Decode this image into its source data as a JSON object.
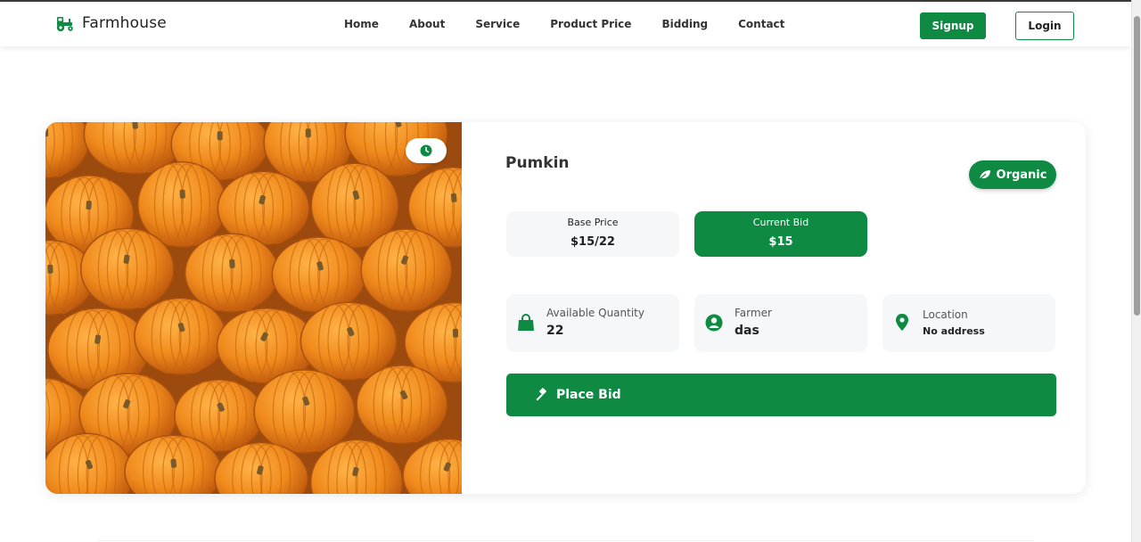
{
  "brand": {
    "name": "Farmhouse",
    "icon": "tractor-icon",
    "color": "#0e8a43"
  },
  "nav": {
    "links": [
      "Home",
      "About",
      "Service",
      "Product Price",
      "Bidding",
      "Contact"
    ],
    "signup_label": "Signup",
    "login_label": "Login"
  },
  "product": {
    "title": "Pumkin",
    "organic_label": "Organic",
    "base_price_label": "Base Price",
    "base_price_value": "$15/22",
    "current_bid_label": "Current Bid",
    "current_bid_value": "$15",
    "quantity_label": "Available Quantity",
    "quantity_value": "22",
    "farmer_label": "Farmer",
    "farmer_value": "das",
    "location_label": "Location",
    "location_value": "No address",
    "place_bid_label": "Place Bid",
    "image_subject": "pile of orange pumpkins"
  },
  "colors": {
    "accent": "#0e8a43",
    "panel": "#f6f7f9"
  }
}
